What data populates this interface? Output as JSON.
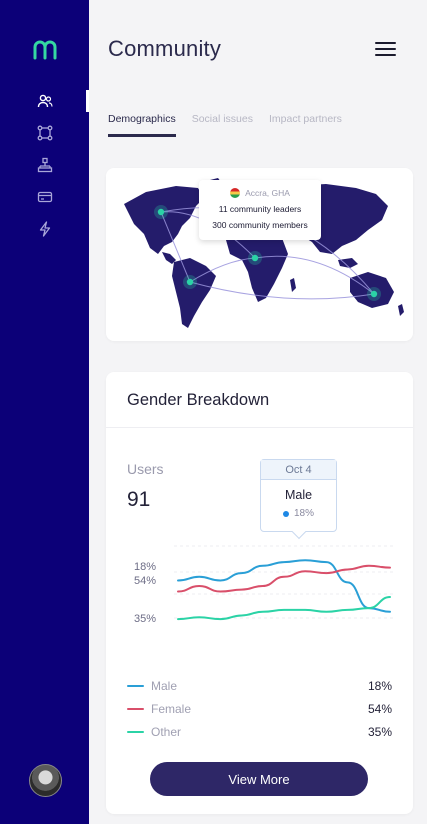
{
  "header": {
    "title": "Community"
  },
  "tabs": [
    {
      "label": "Demographics",
      "active": true
    },
    {
      "label": "Social issues",
      "active": false
    },
    {
      "label": "Impact partners",
      "active": false
    }
  ],
  "sidebar": {
    "items": [
      {
        "icon": "users-icon",
        "active": true
      },
      {
        "icon": "nodes-icon",
        "active": false
      },
      {
        "icon": "hierarchy-icon",
        "active": false
      },
      {
        "icon": "card-icon",
        "active": false
      },
      {
        "icon": "lightning-icon",
        "active": false
      }
    ]
  },
  "map": {
    "location": "Accra, GHA",
    "leaders": "11 community leaders",
    "members": "300 community members"
  },
  "gender": {
    "title": "Gender Breakdown",
    "users_label": "Users",
    "users_value": "91",
    "tooltip": {
      "date": "Oct 4",
      "series": "Male",
      "value": "18%"
    },
    "axis_labels": [
      "18%",
      "54%",
      "35%"
    ],
    "legend": [
      {
        "name": "Male",
        "value": "18%",
        "color": "#2a9fd6"
      },
      {
        "name": "Female",
        "value": "54%",
        "color": "#d94f6a"
      },
      {
        "name": "Other",
        "value": "35%",
        "color": "#2bd3a6"
      }
    ],
    "button_label": "View More"
  },
  "colors": {
    "sidebar": "#0c0078",
    "accent": "#2e2767",
    "map_land": "#241c6b"
  },
  "chart_data": {
    "type": "line",
    "title": "Gender Breakdown",
    "series": [
      {
        "name": "Male",
        "values": [
          18,
          20,
          18,
          22,
          26,
          28,
          29,
          28,
          17,
          3,
          1
        ]
      },
      {
        "name": "Female",
        "values": [
          12,
          15,
          12,
          13,
          15,
          20,
          23,
          22,
          24,
          26,
          25
        ]
      },
      {
        "name": "Other",
        "values": [
          -3,
          -2,
          -3,
          -1,
          1,
          2,
          2,
          1,
          2,
          3,
          9
        ]
      }
    ]
  }
}
